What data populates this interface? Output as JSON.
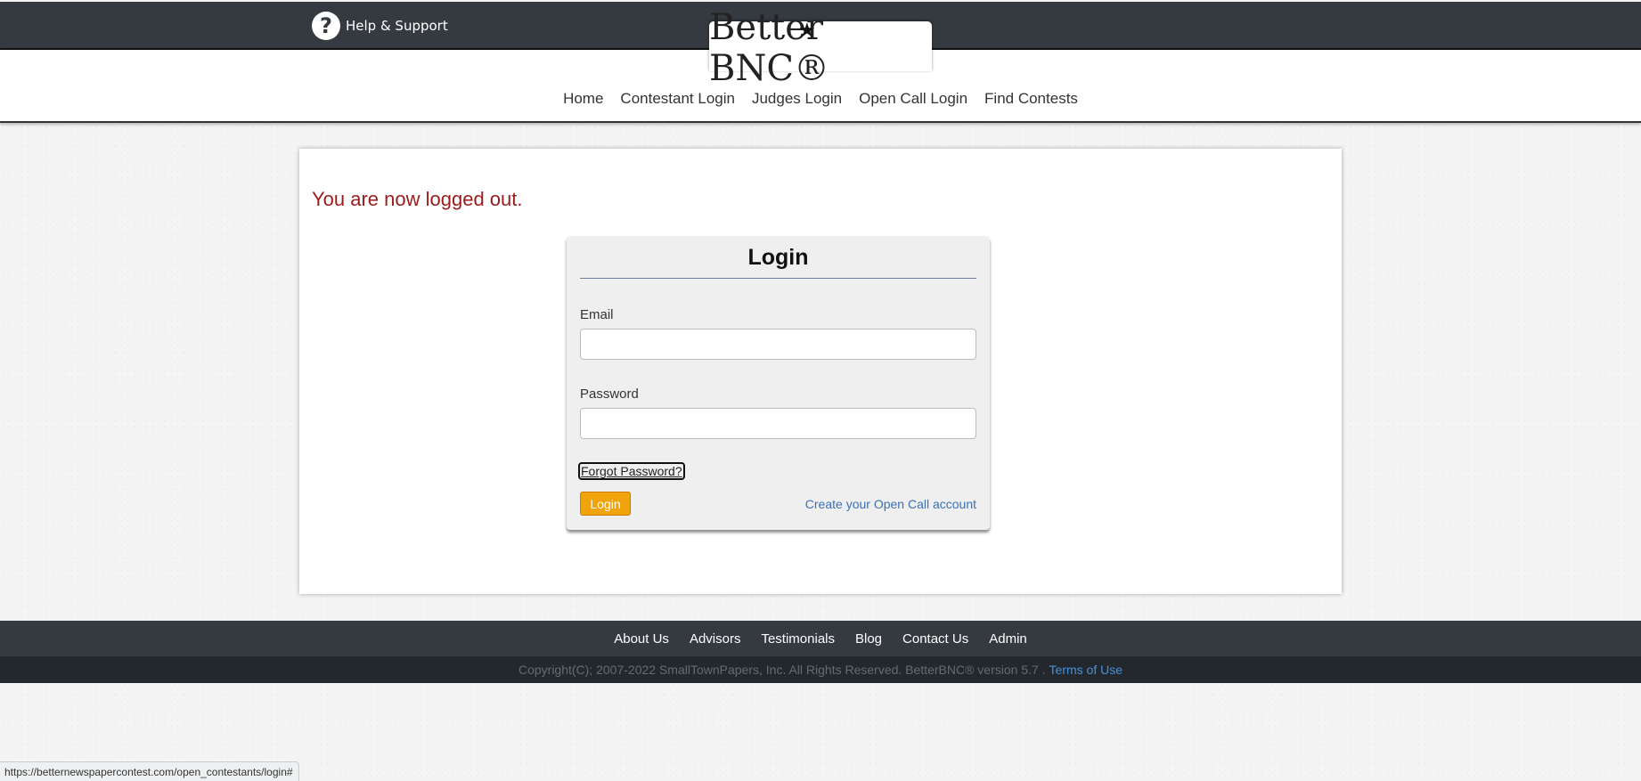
{
  "header": {
    "help_label": "Help & Support",
    "help_icon": "question-circle-icon",
    "logo_text": "Better BNC®"
  },
  "nav": {
    "items": [
      {
        "label": "Home"
      },
      {
        "label": "Contestant Login"
      },
      {
        "label": "Judges Login"
      },
      {
        "label": "Open Call Login"
      },
      {
        "label": "Find Contests"
      }
    ]
  },
  "main": {
    "message": "You are now logged out.",
    "message_color": "#9c1b1b"
  },
  "login": {
    "title": "Login",
    "email_label": "Email",
    "email_value": "",
    "password_label": "Password",
    "password_value": "",
    "forgot_label": "Forgot Password?",
    "login_button": "Login",
    "create_account_label": "Create your Open Call account",
    "button_color": "#f0a30a"
  },
  "footer": {
    "links": [
      {
        "label": "About Us"
      },
      {
        "label": "Advisors"
      },
      {
        "label": "Testimonials"
      },
      {
        "label": "Blog"
      },
      {
        "label": "Contact Us"
      },
      {
        "label": "Admin"
      }
    ],
    "copyright": "Copyright(C); 2007-2022 SmallTownPapers, Inc. All Rights Reserved. BetterBNC® version 5.7 .",
    "terms_label": "Terms of Use"
  },
  "statusbar": {
    "url": "https://betternewspapercontest.com/open_contestants/login#"
  }
}
